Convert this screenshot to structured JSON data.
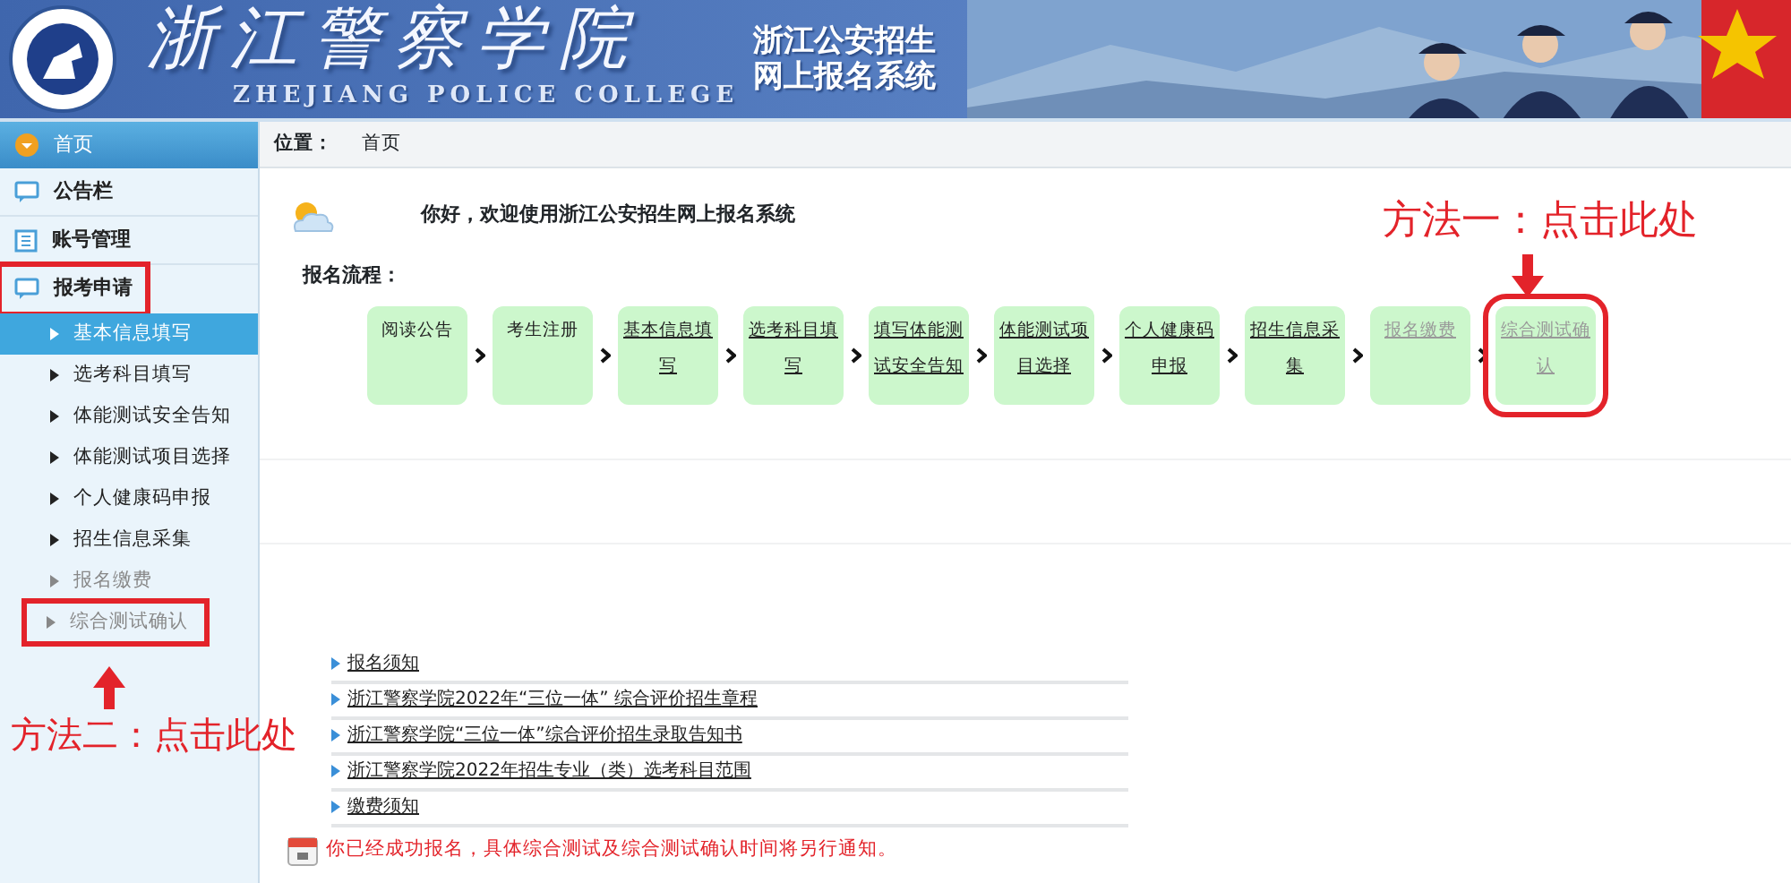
{
  "banner": {
    "title": "浙江警察学院",
    "subtitle": "ZHEJIANG POLICE COLLEGE",
    "system_name": [
      "浙江公安招生",
      "网上报名系统"
    ]
  },
  "sidebar": {
    "home": "首页",
    "items": [
      {
        "label": "公告栏",
        "highlighted": false
      },
      {
        "label": "账号管理",
        "highlighted": false
      },
      {
        "label": "报考申请",
        "highlighted": true,
        "children": [
          {
            "label": "基本信息填写",
            "selected": true,
            "disabled": false,
            "highlighted": false
          },
          {
            "label": "选考科目填写",
            "selected": false,
            "disabled": false,
            "highlighted": false
          },
          {
            "label": "体能测试安全告知",
            "selected": false,
            "disabled": false,
            "highlighted": false
          },
          {
            "label": "体能测试项目选择",
            "selected": false,
            "disabled": false,
            "highlighted": false
          },
          {
            "label": "个人健康码申报",
            "selected": false,
            "disabled": false,
            "highlighted": false
          },
          {
            "label": "招生信息采集",
            "selected": false,
            "disabled": false,
            "highlighted": false
          },
          {
            "label": "报名缴费",
            "selected": false,
            "disabled": true,
            "highlighted": false
          },
          {
            "label": "综合测试确认",
            "selected": false,
            "disabled": true,
            "highlighted": true
          }
        ]
      }
    ]
  },
  "breadcrumb": {
    "label": "位置：",
    "path": "首页"
  },
  "welcome": "你好，欢迎使用浙江公安招生网上报名系统",
  "process": {
    "title": "报名流程：",
    "steps": [
      {
        "label": "阅读公告",
        "kind": "plain",
        "highlighted": false
      },
      {
        "label": "考生注册",
        "kind": "plain",
        "highlighted": false
      },
      {
        "label": "基本信息填写",
        "kind": "link",
        "highlighted": false
      },
      {
        "label": "选考科目填写",
        "kind": "link",
        "highlighted": false
      },
      {
        "label": "填写体能测试安全告知",
        "kind": "link",
        "highlighted": false
      },
      {
        "label": "体能测试项目选择",
        "kind": "link",
        "highlighted": false
      },
      {
        "label": "个人健康码申报",
        "kind": "link",
        "highlighted": false
      },
      {
        "label": "招生信息采集",
        "kind": "link",
        "highlighted": false
      },
      {
        "label": "报名缴费",
        "kind": "disabled",
        "highlighted": false
      },
      {
        "label": "综合测试确认",
        "kind": "disabled",
        "highlighted": true
      }
    ]
  },
  "links": [
    "报名须知",
    "浙江警察学院2022年“三位一体” 综合评价招生章程",
    "浙江警察学院“三位一体”综合评价招生录取告知书",
    "浙江警察学院2022年招生专业（类）选考科目范围",
    "缴费须知"
  ],
  "notice": "你已经成功报名，具体综合测试及综合测试确认时间将另行通知。",
  "annotations": [
    "方法一：点击此处",
    "方法二：点击此处"
  ]
}
